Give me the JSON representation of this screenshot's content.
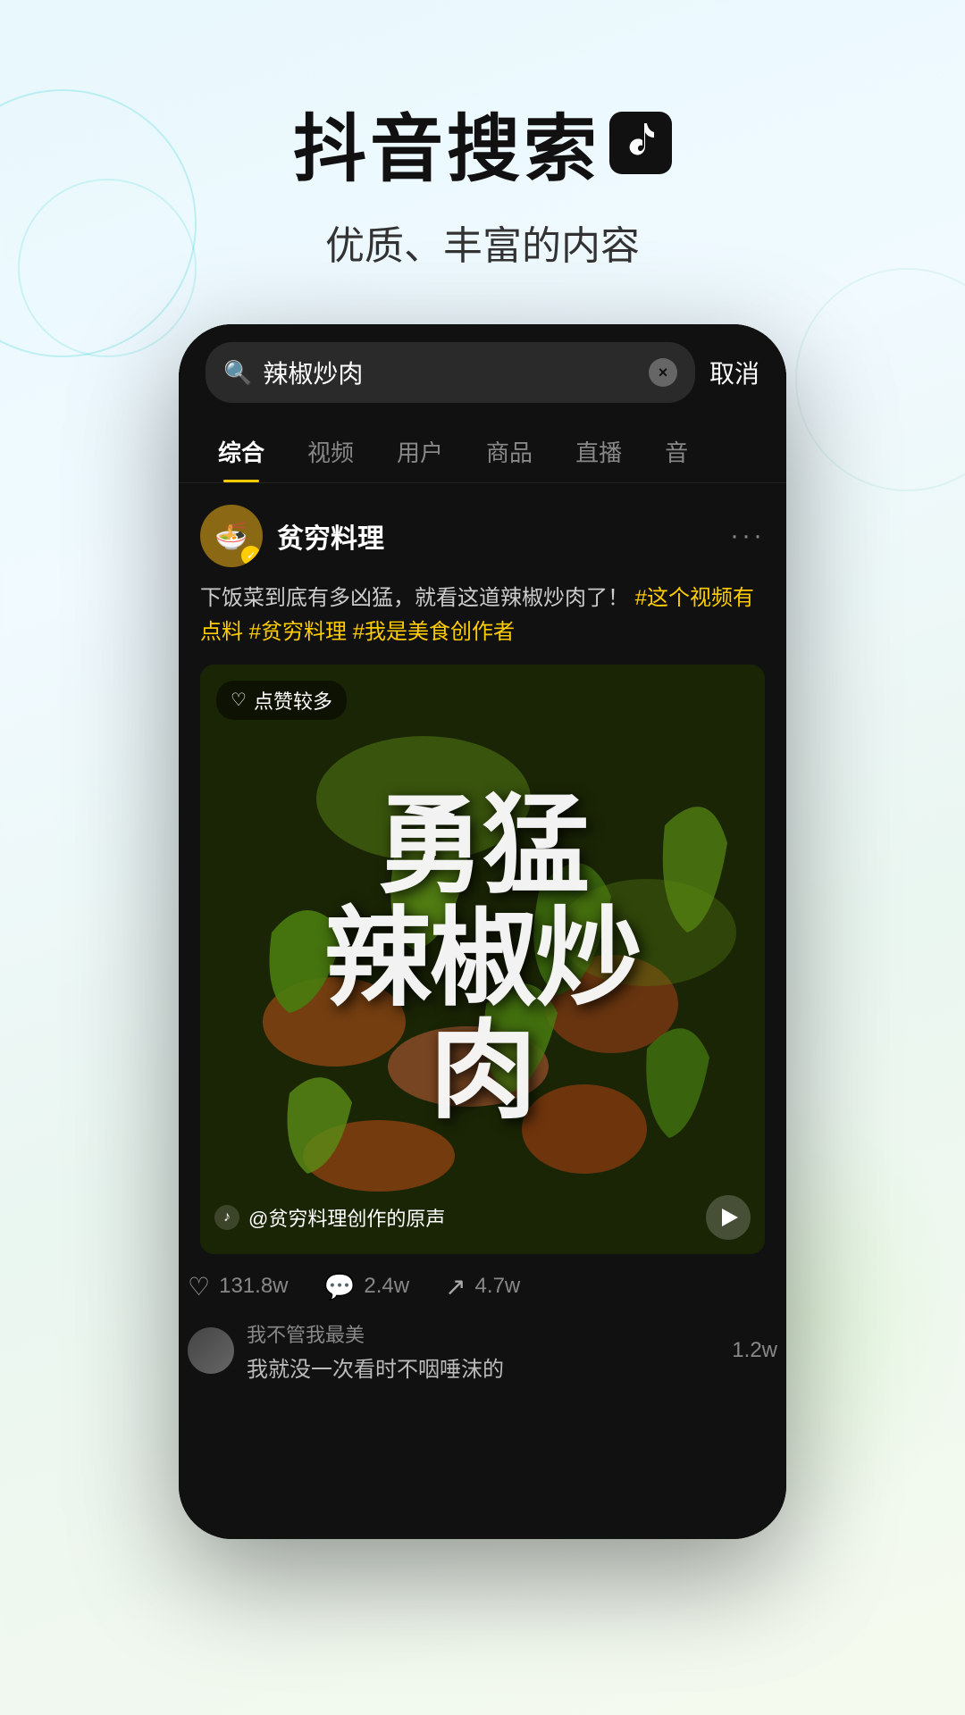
{
  "header": {
    "title": "抖音搜索",
    "subtitle": "优质、丰富的内容",
    "logo_icon": "♪"
  },
  "phone": {
    "search": {
      "placeholder": "辣椒炒肉",
      "clear_label": "×",
      "cancel_label": "取消"
    },
    "tabs": [
      {
        "label": "综合",
        "active": true
      },
      {
        "label": "视频",
        "active": false
      },
      {
        "label": "用户",
        "active": false
      },
      {
        "label": "商品",
        "active": false
      },
      {
        "label": "直播",
        "active": false
      },
      {
        "label": "音",
        "active": false
      }
    ],
    "post": {
      "username": "贫穷料理",
      "verified": true,
      "description": "下饭菜到底有多凶猛，就看这道辣椒炒肉了！",
      "hashtags": [
        "#这个视频有点料",
        "#贫穷料理",
        "#我是美食创作者"
      ],
      "video_badge": "点赞较多",
      "video_text_lines": [
        "勇猛",
        "辣椒炒",
        "肉"
      ],
      "video_text_combined": "勇猛辣椒炒肉",
      "audio_info": "@贫穷料理创作的原声",
      "stats": {
        "likes": "131.8w",
        "comments": "2.4w",
        "shares": "4.7w"
      },
      "comment": {
        "text": "我就没一次看时不咽唾沫的",
        "user": "我不管我最美",
        "count": "1.2w"
      }
    }
  }
}
